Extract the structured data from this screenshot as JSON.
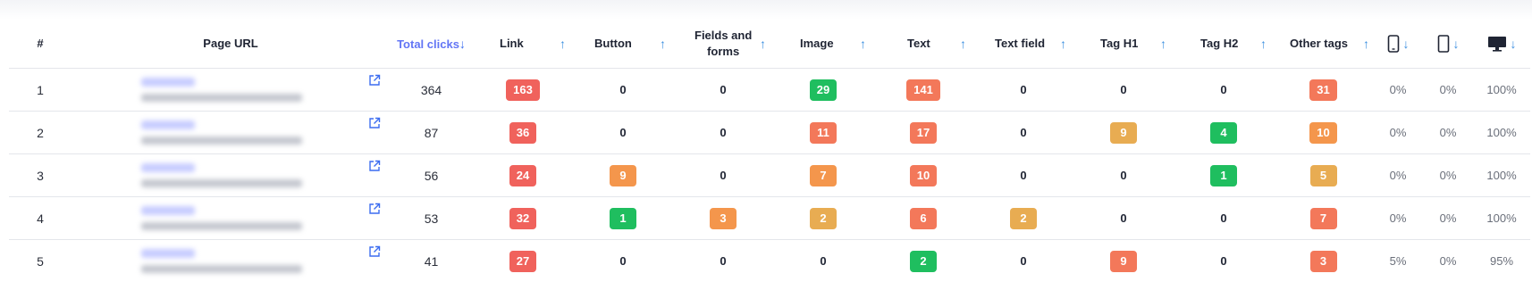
{
  "colors": {
    "red": "#f0625c",
    "red_orange": "#f3785a",
    "orange": "#f4964c",
    "amber": "#e8ac52",
    "green": "#1fbe5f",
    "link_blue": "#6275f5",
    "arrow_blue": "#3b8fe0"
  },
  "headers": {
    "index": "#",
    "page_url": "Page URL",
    "total_clicks": "Total clicks",
    "link": "Link",
    "button": "Button",
    "fields_forms_1": "Fields and",
    "fields_forms_2": "forms",
    "image": "Image",
    "text": "Text",
    "text_field": "Text field",
    "tag_h1": "Tag H1",
    "tag_h2": "Tag H2",
    "other_tags": "Other tags",
    "sort_up": "↑",
    "sort_down": "↓"
  },
  "device_icons": [
    "smartphone-icon",
    "tablet-icon",
    "desktop-icon"
  ],
  "rows": [
    {
      "index": "1",
      "clicks": "364",
      "link": "163",
      "button": "0",
      "fields": "0",
      "image": "29",
      "text": "141",
      "text_field": "0",
      "h1": "0",
      "h2": "0",
      "other": "31",
      "mobile": "0%",
      "tablet": "0%",
      "desktop": "100%"
    },
    {
      "index": "2",
      "clicks": "87",
      "link": "36",
      "button": "0",
      "fields": "0",
      "image": "11",
      "text": "17",
      "text_field": "0",
      "h1": "9",
      "h2": "4",
      "other": "10",
      "mobile": "0%",
      "tablet": "0%",
      "desktop": "100%"
    },
    {
      "index": "3",
      "clicks": "56",
      "link": "24",
      "button": "9",
      "fields": "0",
      "image": "7",
      "text": "10",
      "text_field": "0",
      "h1": "0",
      "h2": "1",
      "other": "5",
      "mobile": "0%",
      "tablet": "0%",
      "desktop": "100%"
    },
    {
      "index": "4",
      "clicks": "53",
      "link": "32",
      "button": "1",
      "fields": "3",
      "image": "2",
      "text": "6",
      "text_field": "2",
      "h1": "0",
      "h2": "0",
      "other": "7",
      "mobile": "0%",
      "tablet": "0%",
      "desktop": "100%"
    },
    {
      "index": "5",
      "clicks": "41",
      "link": "27",
      "button": "0",
      "fields": "0",
      "image": "0",
      "text": "2",
      "text_field": "0",
      "h1": "9",
      "h2": "0",
      "other": "3",
      "mobile": "5%",
      "tablet": "0%",
      "desktop": "95%"
    }
  ]
}
